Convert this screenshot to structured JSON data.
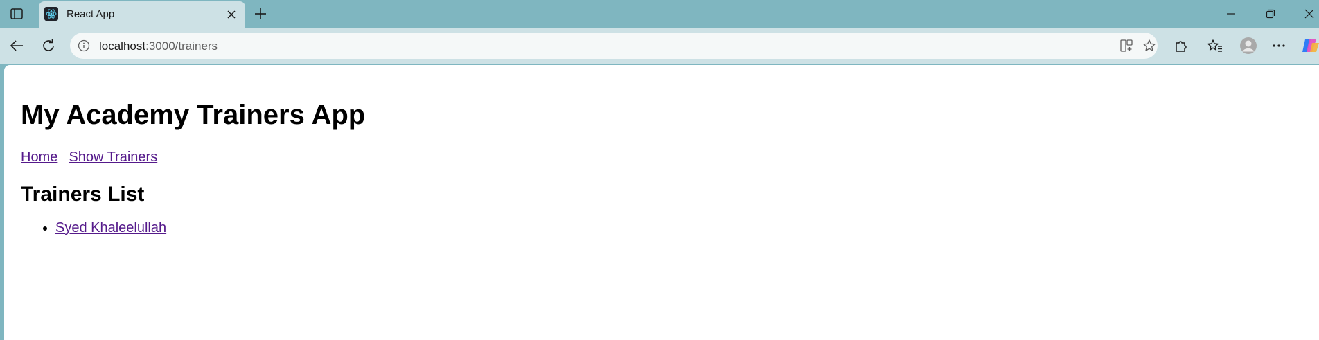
{
  "browser": {
    "tab": {
      "title": "React App"
    },
    "address": {
      "host": "localhost",
      "path": ":3000/trainers"
    },
    "icons": {
      "sidebar": "sidebar-toggle-icon",
      "favicon": "react-logo-icon",
      "tab_close": "close-icon",
      "new_tab": "plus-icon",
      "minimize": "minimize-icon",
      "restore": "restore-icon",
      "window_close": "close-icon",
      "back": "back-arrow-icon",
      "refresh": "refresh-icon",
      "site_info": "info-icon",
      "split_screen": "split-screen-icon",
      "favorite": "star-icon",
      "extensions": "puzzle-icon",
      "favorites": "favorites-icon",
      "profile": "avatar-icon",
      "more": "more-icon",
      "copilot": "copilot-icon"
    },
    "accent": "#7fb6c0"
  },
  "page": {
    "title": "My Academy Trainers App",
    "nav": [
      {
        "label": "Home"
      },
      {
        "label": "Show Trainers"
      }
    ],
    "section_title": "Trainers List",
    "trainers": [
      {
        "name": "Syed Khaleelullah"
      }
    ],
    "link_color": "#551a8b"
  }
}
